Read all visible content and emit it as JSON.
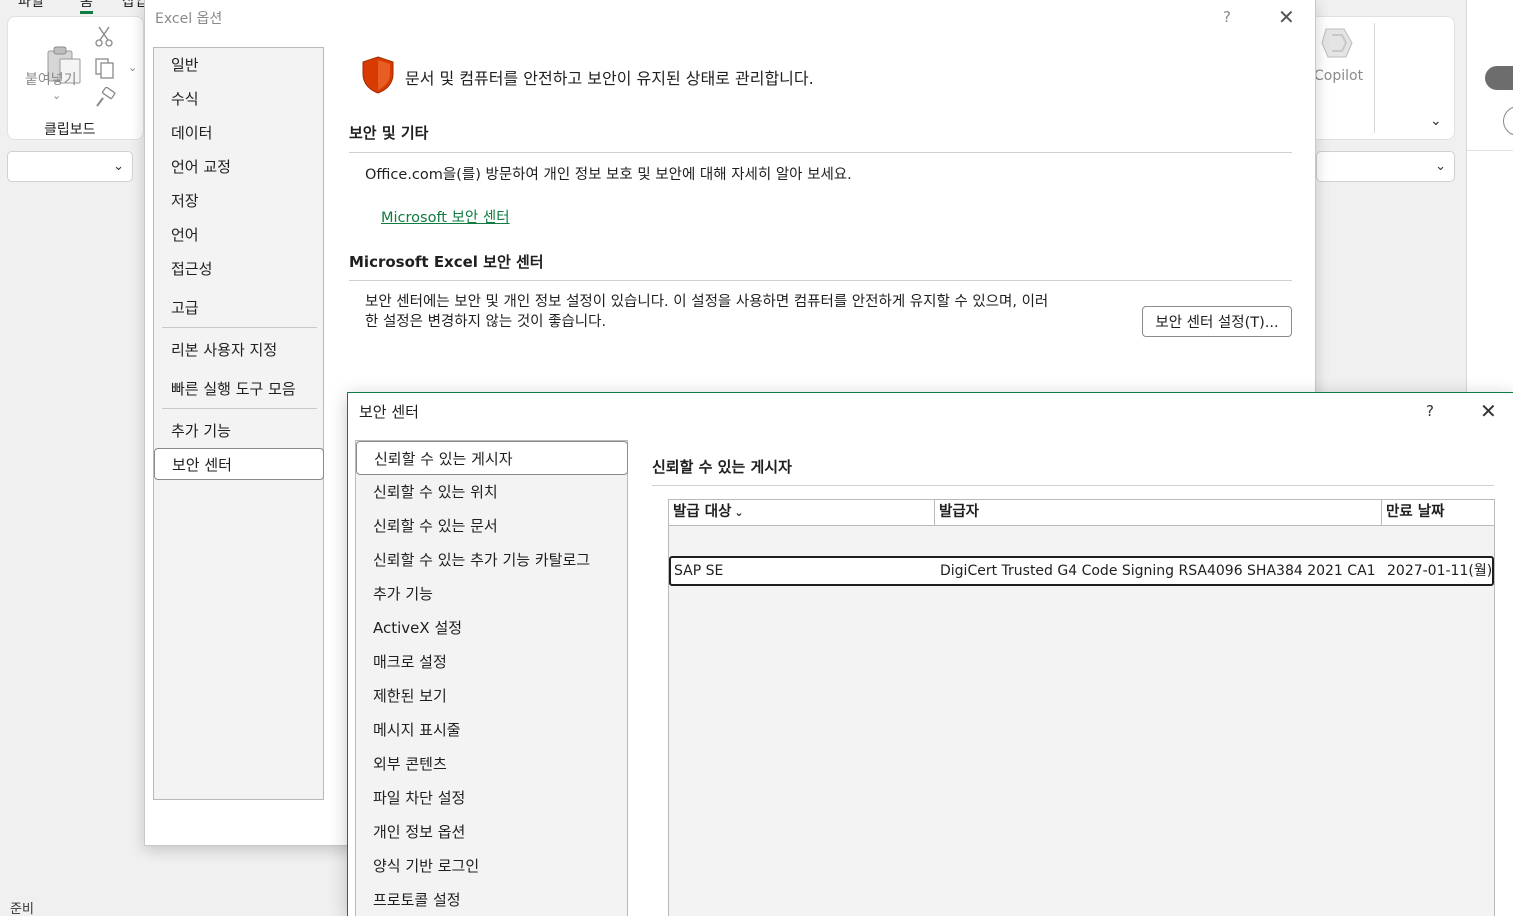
{
  "excel": {
    "tabs": [
      "파일",
      "홈",
      "삽입"
    ],
    "ribbon": {
      "paste_label": "붙여넣기",
      "clipboard_group": "클립보드",
      "copilot_label": "Copilot"
    },
    "status": "준비"
  },
  "options": {
    "title": "Excel 옵션",
    "help": "?",
    "nav": [
      "일반",
      "수식",
      "데이터",
      "언어 교정",
      "저장",
      "언어",
      "접근성",
      "고급",
      "리본 사용자 지정",
      "빠른 실행 도구 모음",
      "추가 기능",
      "보안 센터"
    ],
    "headline": "문서 및 컴퓨터를 안전하고 보안이 유지된 상태로 관리합니다.",
    "section1": {
      "title": "보안 및 기타",
      "text": "Office.com을(를) 방문하여 개인 정보 보호 및 보안에 대해 자세히 알아 보세요.",
      "link": "Microsoft 보안 센터"
    },
    "section2": {
      "title": "Microsoft Excel 보안 센터",
      "text_line1": "보안 센터에는 보안 및 개인 정보 설정이 있습니다. 이 설정을 사용하면 컴퓨터를 안전하게 유지할 수 있으며, 이러",
      "text_line2": "한 설정은 변경하지 않는 것이 좋습니다.",
      "button": "보안 센터 설정(T)..."
    }
  },
  "trust_center": {
    "title": "보안 센터",
    "help": "?",
    "nav": [
      "신뢰할 수 있는 게시자",
      "신뢰할 수 있는 위치",
      "신뢰할 수 있는 문서",
      "신뢰할 수 있는 추가 기능 카탈로그",
      "추가 기능",
      "ActiveX 설정",
      "매크로 설정",
      "제한된 보기",
      "메시지 표시줄",
      "외부 콘텐츠",
      "파일 차단 설정",
      "개인 정보 옵션",
      "양식 기반 로그인",
      "프로토콜 설정"
    ],
    "heading": "신뢰할 수 있는 게시자",
    "columns": [
      "발급 대상",
      "발급자",
      "만료 날짜"
    ],
    "rows": [
      {
        "issued_to": "SAP SE",
        "issuer": "DigiCert Trusted G4 Code Signing RSA4096 SHA384 2021 CA1",
        "expires": "2027-01-11(월)"
      }
    ]
  }
}
